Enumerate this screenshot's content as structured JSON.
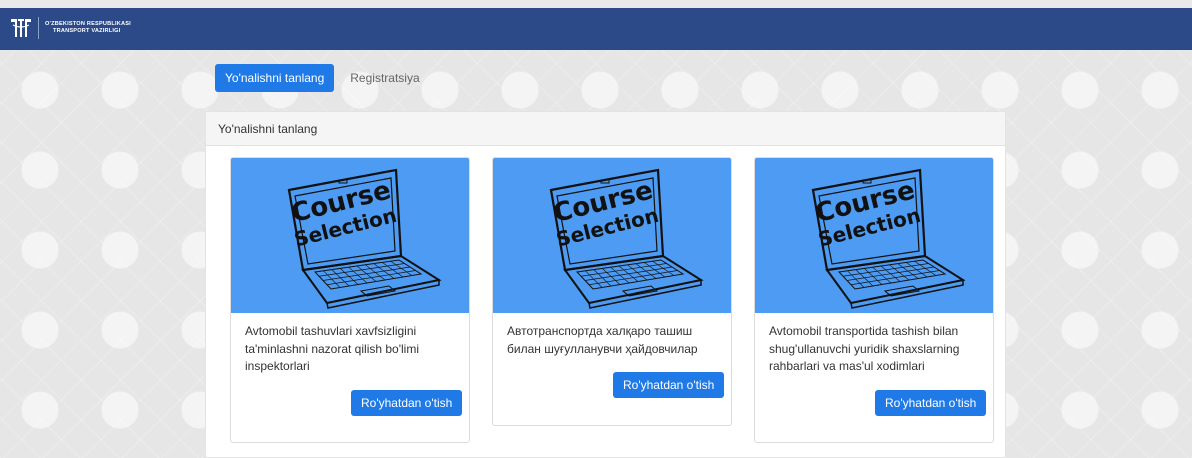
{
  "header": {
    "org_line1": "O'ZBEKISTON RESPUBLIKASI",
    "org_line2": "TRANSPORT VAZIRLIGI",
    "bg_color": "#2b4a87"
  },
  "tabs": [
    {
      "label": "Yo'nalishni tanlang",
      "active": true
    },
    {
      "label": "Registratsiya",
      "active": false
    }
  ],
  "panel": {
    "title": "Yo'nalishni tanlang"
  },
  "cards": [
    {
      "image_text_1": "Course",
      "image_text_2": "Selection",
      "description": "Avtomobil tashuvlari xavfsizligini ta'minlashni nazorat qilish bo'limi inspektorlari",
      "button_label": "Ro'yhatdan o'tish"
    },
    {
      "image_text_1": "Course",
      "image_text_2": "Selection",
      "description": "Автотранспортда халқаро ташиш билан шуғулланувчи ҳайдовчилар",
      "button_label": "Ro'yhatdan o'tish"
    },
    {
      "image_text_1": "Course",
      "image_text_2": "Selection",
      "description": "Avtomobil transportida tashish bilan shug'ullanuvchi yuridik shaxslarning rahbarlari va mas'ul xodimlari",
      "button_label": "Ro'yhatdan o'tish"
    }
  ],
  "colors": {
    "accent": "#1f7ae8",
    "card_image_bg": "#4d9bf2"
  }
}
